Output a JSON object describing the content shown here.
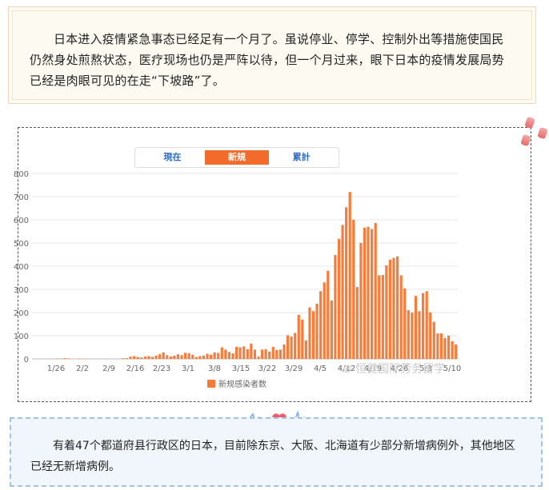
{
  "intro": {
    "text": "日本进入疫情紧急事态已经足有一个月了。虽说停业、停学、控制外出等措施使国民仍然身处煎熬状态，医疗现场也仍是严阵以待，但一个月过来，眼下日本的疫情发展局势已经是肉眼可见的在走“下坡路”了。"
  },
  "tabs": [
    {
      "label": "現在",
      "active": false
    },
    {
      "label": "新規",
      "active": true
    },
    {
      "label": "累計",
      "active": false
    }
  ],
  "watermark": "恒健国际劳务留学",
  "chart_data": {
    "type": "bar",
    "ylim": [
      0,
      800
    ],
    "yticks": [
      0,
      100,
      200,
      300,
      400,
      500,
      600,
      700,
      800
    ],
    "grid": true,
    "legend_position": "bottom",
    "color": "#f57c3a",
    "series": [
      {
        "name": "新规感染者数",
        "values": [
          0,
          0,
          0,
          0,
          0,
          0,
          2,
          1,
          3,
          2,
          0,
          0,
          2,
          1,
          0,
          0,
          0,
          0,
          0,
          1,
          0,
          0,
          0,
          0,
          3,
          3,
          10,
          12,
          8,
          6,
          10,
          12,
          9,
          14,
          20,
          28,
          16,
          10,
          14,
          20,
          16,
          26,
          24,
          18,
          8,
          12,
          14,
          22,
          18,
          28,
          26,
          50,
          40,
          30,
          24,
          52,
          50,
          54,
          42,
          66,
          40,
          10,
          40,
          42,
          32,
          52,
          38,
          40,
          62,
          102,
          96,
          112,
          190,
          170,
          80,
          222,
          206,
          238,
          292,
          330,
          380,
          252,
          448,
          518,
          578,
          654,
          720,
          600,
          310,
          500,
          566,
          570,
          560,
          586,
          360,
          362,
          404,
          428,
          436,
          442,
          360,
          304,
          210,
          200,
          272,
          206,
          284,
          292,
          200,
          160,
          110,
          110,
          90,
          100,
          76,
          62
        ]
      }
    ],
    "xtick_labels": [
      "1/26",
      "2/2",
      "2/9",
      "2/16",
      "2/23",
      "3/1",
      "3/8",
      "3/15",
      "3/22",
      "3/29",
      "4/5",
      "4/12",
      "4/19",
      "4/26",
      "5/3",
      "5/10"
    ],
    "xtick_label_note": "x tick labels at weekly positions"
  },
  "closing": {
    "text": "有着47个都道府县行政区的日本，目前除东京、大阪、北海道有少部分新增病例外，其他地区已经无新增病例。"
  }
}
